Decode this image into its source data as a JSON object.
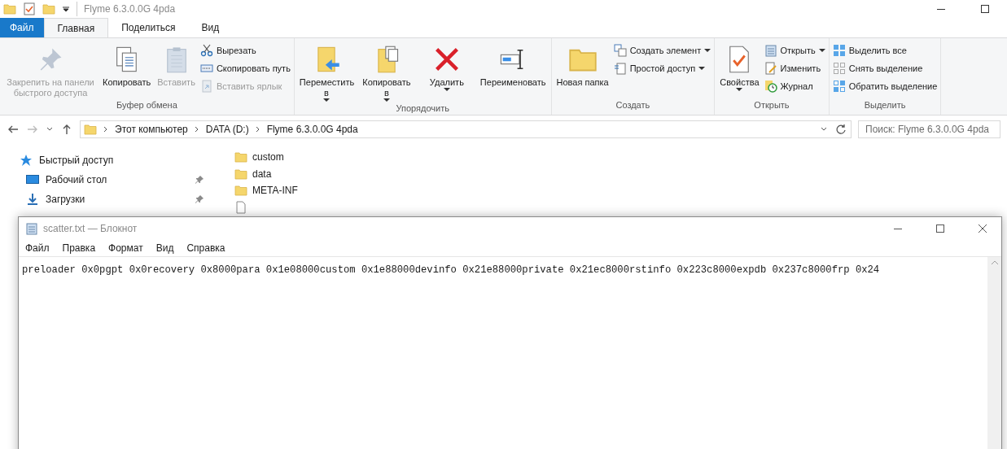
{
  "explorer": {
    "title": "Flyme 6.3.0.0G 4pda",
    "tabs": [
      {
        "label": "Файл",
        "kind": "file",
        "selected": false
      },
      {
        "label": "Главная",
        "kind": "tab",
        "selected": true
      },
      {
        "label": "Поделиться",
        "kind": "tab",
        "selected": false
      },
      {
        "label": "Вид",
        "kind": "tab",
        "selected": false
      }
    ],
    "ribbon_groups": [
      {
        "label": "Буфер обмена",
        "large": [
          {
            "label": "Закрепить на панели быстрого доступа",
            "kind": "pin",
            "disabled": true,
            "dropdown": false
          },
          {
            "label": "Копировать",
            "kind": "copy",
            "disabled": false,
            "dropdown": false
          },
          {
            "label": "Вставить",
            "kind": "paste",
            "disabled": true,
            "dropdown": false
          }
        ],
        "small": [
          {
            "label": "Вырезать",
            "kind": "scissors",
            "disabled": false,
            "dropdown": false
          },
          {
            "label": "Скопировать путь",
            "kind": "path",
            "disabled": false,
            "dropdown": false
          },
          {
            "label": "Вставить ярлык",
            "kind": "shortcut",
            "disabled": true,
            "dropdown": false
          }
        ]
      },
      {
        "label": "Упорядочить",
        "large": [
          {
            "label": "Переместить в",
            "kind": "move",
            "disabled": false,
            "dropdown": true
          },
          {
            "label": "Копировать в",
            "kind": "copyto",
            "disabled": false,
            "dropdown": true
          },
          {
            "label": "Удалить",
            "kind": "delete",
            "disabled": false,
            "dropdown": true
          },
          {
            "label": "Переименовать",
            "kind": "rename",
            "disabled": false,
            "dropdown": false
          }
        ]
      },
      {
        "label": "Создать",
        "large": [
          {
            "label": "Новая папка",
            "kind": "folder",
            "disabled": false,
            "dropdown": false
          }
        ],
        "small": [
          {
            "label": "Создать элемент",
            "kind": "newitem",
            "disabled": false,
            "dropdown": true
          },
          {
            "label": "Простой доступ",
            "kind": "easy",
            "disabled": false,
            "dropdown": true
          }
        ]
      },
      {
        "label": "Открыть",
        "large": [
          {
            "label": "Свойства",
            "kind": "props",
            "disabled": false,
            "dropdown": true
          }
        ],
        "small": [
          {
            "label": "Открыть",
            "kind": "open",
            "disabled": false,
            "dropdown": true
          },
          {
            "label": "Изменить",
            "kind": "edit",
            "disabled": false,
            "dropdown": false
          },
          {
            "label": "Журнал",
            "kind": "history",
            "disabled": false,
            "dropdown": false
          }
        ]
      },
      {
        "label": "Выделить",
        "small": [
          {
            "label": "Выделить все",
            "kind": "selall",
            "disabled": false,
            "dropdown": false
          },
          {
            "label": "Снять выделение",
            "kind": "selnone",
            "disabled": false,
            "dropdown": false
          },
          {
            "label": "Обратить выделение",
            "kind": "selinv",
            "disabled": false,
            "dropdown": false
          }
        ]
      }
    ],
    "breadcrumb": [
      "Этот компьютер",
      "DATA (D:)",
      "Flyme 6.3.0.0G 4pda"
    ],
    "search": {
      "placeholder": "Поиск: Flyme 6.3.0.0G 4pda"
    },
    "nav": [
      {
        "label": "Быстрый доступ",
        "kind": "star",
        "pinned": false
      },
      {
        "label": "Рабочий стол",
        "kind": "desktop",
        "pinned": true
      },
      {
        "label": "Загрузки",
        "kind": "download",
        "pinned": true
      }
    ],
    "files": [
      {
        "name": "custom",
        "kind": "folder"
      },
      {
        "name": "data",
        "kind": "folder"
      },
      {
        "name": "META-INF",
        "kind": "folder"
      },
      {
        "kind": "file"
      }
    ]
  },
  "notepad": {
    "title": "scatter.txt — Блокнот",
    "menu": [
      "Файл",
      "Правка",
      "Формат",
      "Вид",
      "Справка"
    ],
    "text": "preloader 0x0pgpt 0x0recovery 0x8000para 0x1e08000custom 0x1e88000devinfo 0x21e88000private 0x21ec8000rstinfo 0x223c8000expdb 0x237c8000frp 0x24"
  }
}
